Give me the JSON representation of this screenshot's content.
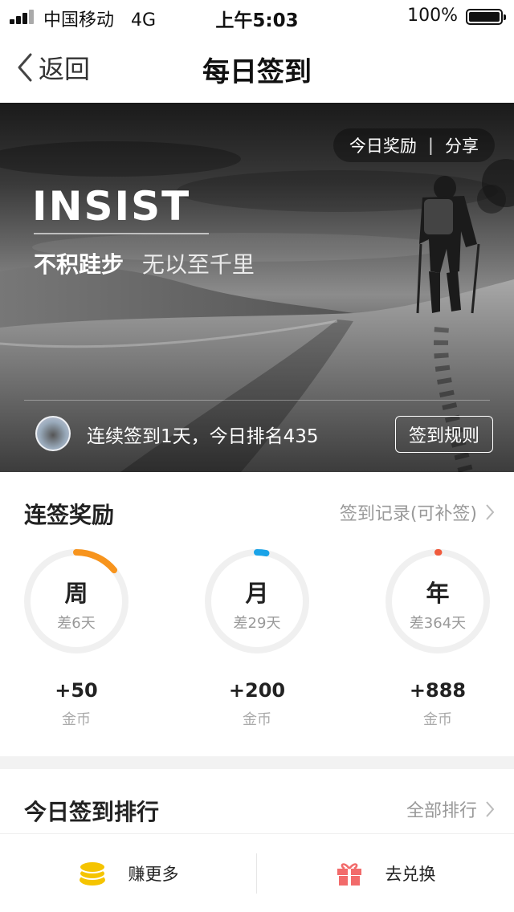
{
  "status_bar": {
    "carrier": "中国移动",
    "network": "4G",
    "time": "上午5:03",
    "battery": "100%"
  },
  "nav": {
    "back_label": "返回",
    "title": "每日签到"
  },
  "hero": {
    "today_reward": "今日奖励",
    "divider": "|",
    "share": "分享",
    "headline": "INSIST",
    "slogan_strong": "不积跬步",
    "slogan_light": "无以至千里",
    "streak_text": "连续签到1天，今日排名435",
    "rules_button": "签到规则"
  },
  "rewards": {
    "title": "连签奖励",
    "record_link": "签到记录(可补签)",
    "rings": [
      {
        "label": "周",
        "sub": "差6天",
        "amount": "+50",
        "unit": "金币",
        "progress": 0.14,
        "color": "#f7941d"
      },
      {
        "label": "月",
        "sub": "差29天",
        "amount": "+200",
        "unit": "金币",
        "progress": 0.03,
        "color": "#1aa3e8"
      },
      {
        "label": "年",
        "sub": "差364天",
        "amount": "+888",
        "unit": "金币",
        "progress": 0.003,
        "color": "#f05a3c"
      }
    ]
  },
  "ranking": {
    "title": "今日签到排行",
    "all_link": "全部排行"
  },
  "bottom_bar": {
    "earn_more": "赚更多",
    "exchange": "去兑换",
    "coin_color": "#f5c400",
    "gift_color": "#f26b6b"
  }
}
